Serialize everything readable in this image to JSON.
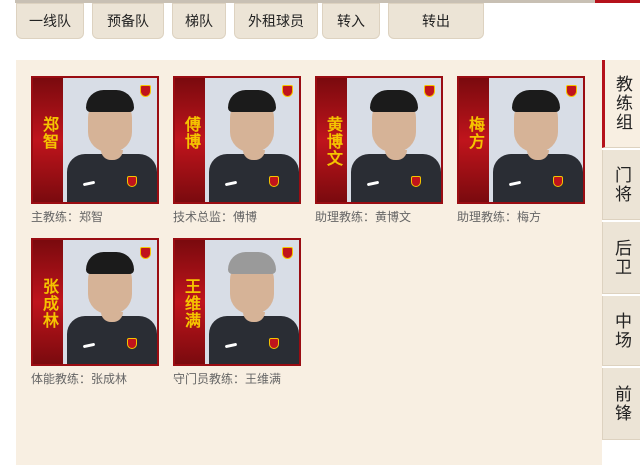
{
  "top_tabs": [
    "一线队",
    "预备队",
    "梯队",
    "外租球员",
    "转入",
    "转出"
  ],
  "side_tabs": [
    "教练组",
    "门将",
    "后卫",
    "中场",
    "前锋"
  ],
  "active_side_tab": "教练组",
  "coaches": [
    {
      "name": "郑智",
      "caption": "主教练：郑智",
      "hair": "dark"
    },
    {
      "name": "傅博",
      "caption": "技术总监：傅博",
      "hair": "dark"
    },
    {
      "name": "黄博文",
      "caption": "助理教练：黄博文",
      "hair": "dark"
    },
    {
      "name": "梅方",
      "caption": "助理教练：梅方",
      "hair": "dark"
    },
    {
      "name": "张成林",
      "caption": "体能教练：张成林",
      "hair": "dark"
    },
    {
      "name": "王维满",
      "caption": "守门员教练：王维满",
      "hair": "gray"
    }
  ]
}
